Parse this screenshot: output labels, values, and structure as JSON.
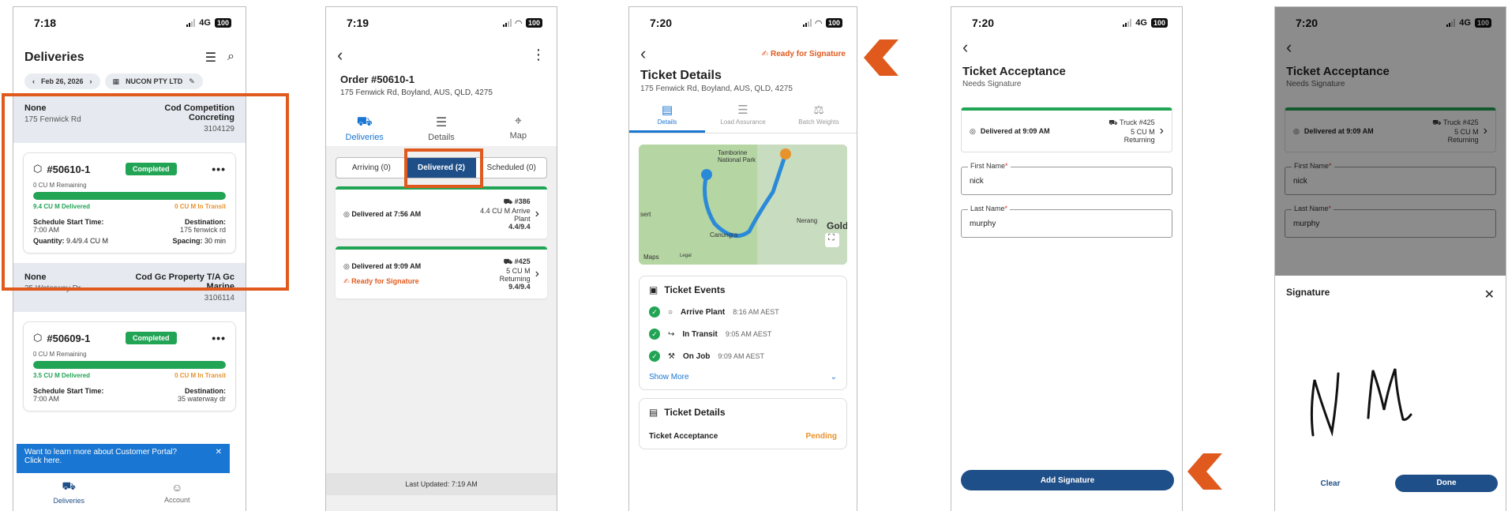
{
  "status": {
    "p1_time": "7:18",
    "p2_time": "7:19",
    "p3_time": "7:20",
    "p4_time": "7:20",
    "p5_time": "7:20",
    "network": "4G",
    "battery": "100"
  },
  "panel1": {
    "title": "Deliveries",
    "date_chip": "Feb 26, 2026",
    "company_chip": "NUCON PTY LTD",
    "groups": [
      {
        "left_title": "None",
        "left_sub": "175 Fenwick Rd",
        "right_title": "Cod Competition Concreting",
        "right_sub": "3104129",
        "card": {
          "number": "#50610-1",
          "status": "Completed",
          "remaining": "0 CU M Remaining",
          "delivered": "9.4 CU M Delivered",
          "in_transit": "0 CU M In Transit",
          "progress": 1.0,
          "start_label": "Schedule Start Time:",
          "start_value": "7:00 AM",
          "dest_label": "Destination:",
          "dest_value": "175 fenwick rd",
          "qty_label": "Quantity:",
          "qty_value": "9.4/9.4 CU M",
          "spacing_label": "Spacing:",
          "spacing_value": "30 min"
        }
      },
      {
        "left_title": "None",
        "left_sub": "35 Waterway Dr",
        "right_title": "Cod Gc Property T/A Gc Marine",
        "right_sub": "3106114",
        "card": {
          "number": "#50609-1",
          "status": "Completed",
          "remaining": "0 CU M Remaining",
          "delivered": "3.5 CU M Delivered",
          "in_transit": "0 CU M In Transit",
          "progress": 1.0,
          "start_label": "Schedule Start Time:",
          "start_value": "7:00 AM",
          "dest_label": "Destination:",
          "dest_value": "35 waterway dr"
        }
      }
    ],
    "banner_line1": "Want to learn more about Customer Portal?",
    "banner_line2": "Click here.",
    "nav": [
      {
        "label": "Deliveries"
      },
      {
        "label": "Account"
      }
    ]
  },
  "panel2": {
    "order_title": "Order #50610-1",
    "address": "175 Fenwick Rd, Boyland, AUS, QLD, 4275",
    "tabs": [
      "Deliveries",
      "Details",
      "Map"
    ],
    "segments": [
      "Arriving (0)",
      "Delivered (2)",
      "Scheduled (0)"
    ],
    "tickets": [
      {
        "status": "Delivered at 7:56 AM",
        "truck": "#386",
        "qty": "4.4 CU M Arrive Plant",
        "ratio": "4.4/9.4",
        "ready": ""
      },
      {
        "status": "Delivered at 9:09 AM",
        "truck": "#425",
        "qty": "5 CU M Returning",
        "ratio": "9.4/9.4",
        "ready": "Ready for Signature"
      }
    ],
    "last_updated": "Last Updated: 7:19 AM"
  },
  "panel3": {
    "ready_label": "Ready for Signature",
    "title": "Ticket Details",
    "address": "175 Fenwick Rd, Boyland, AUS, QLD, 4275",
    "tabs": [
      "Details",
      "Load Assurance",
      "Batch Weights"
    ],
    "map_labels": {
      "park": "Tamborine National Park",
      "nerang": "Nerang",
      "canungra": "Canungra",
      "gold": "Gold",
      "sert": "sert",
      "maps": "Maps",
      "legal": "Legal"
    },
    "events_title": "Ticket Events",
    "events": [
      {
        "name": "Arrive Plant",
        "time": "8:16 AM AEST"
      },
      {
        "name": "In Transit",
        "time": "9:05 AM AEST"
      },
      {
        "name": "On Job",
        "time": "9:09 AM AEST"
      }
    ],
    "show_more": "Show More",
    "details_title": "Ticket Details",
    "acceptance_label": "Ticket Acceptance",
    "acceptance_value": "Pending"
  },
  "panel4": {
    "title": "Ticket Acceptance",
    "subtitle": "Needs Signature",
    "delivered": "Delivered at 9:09 AM",
    "truck": "Truck #425",
    "qty": "5 CU M",
    "state": "Returning",
    "first_name_label": "First Name",
    "first_name_value": "nick",
    "last_name_label": "Last Name",
    "last_name_value": "murphy",
    "add_signature": "Add Signature"
  },
  "panel5": {
    "sheet_title": "Signature",
    "clear": "Clear",
    "done": "Done"
  },
  "colors": {
    "accent": "#1f4f88",
    "highlight": "#e05a1e",
    "green": "#22a455",
    "orange": "#e8922c"
  }
}
